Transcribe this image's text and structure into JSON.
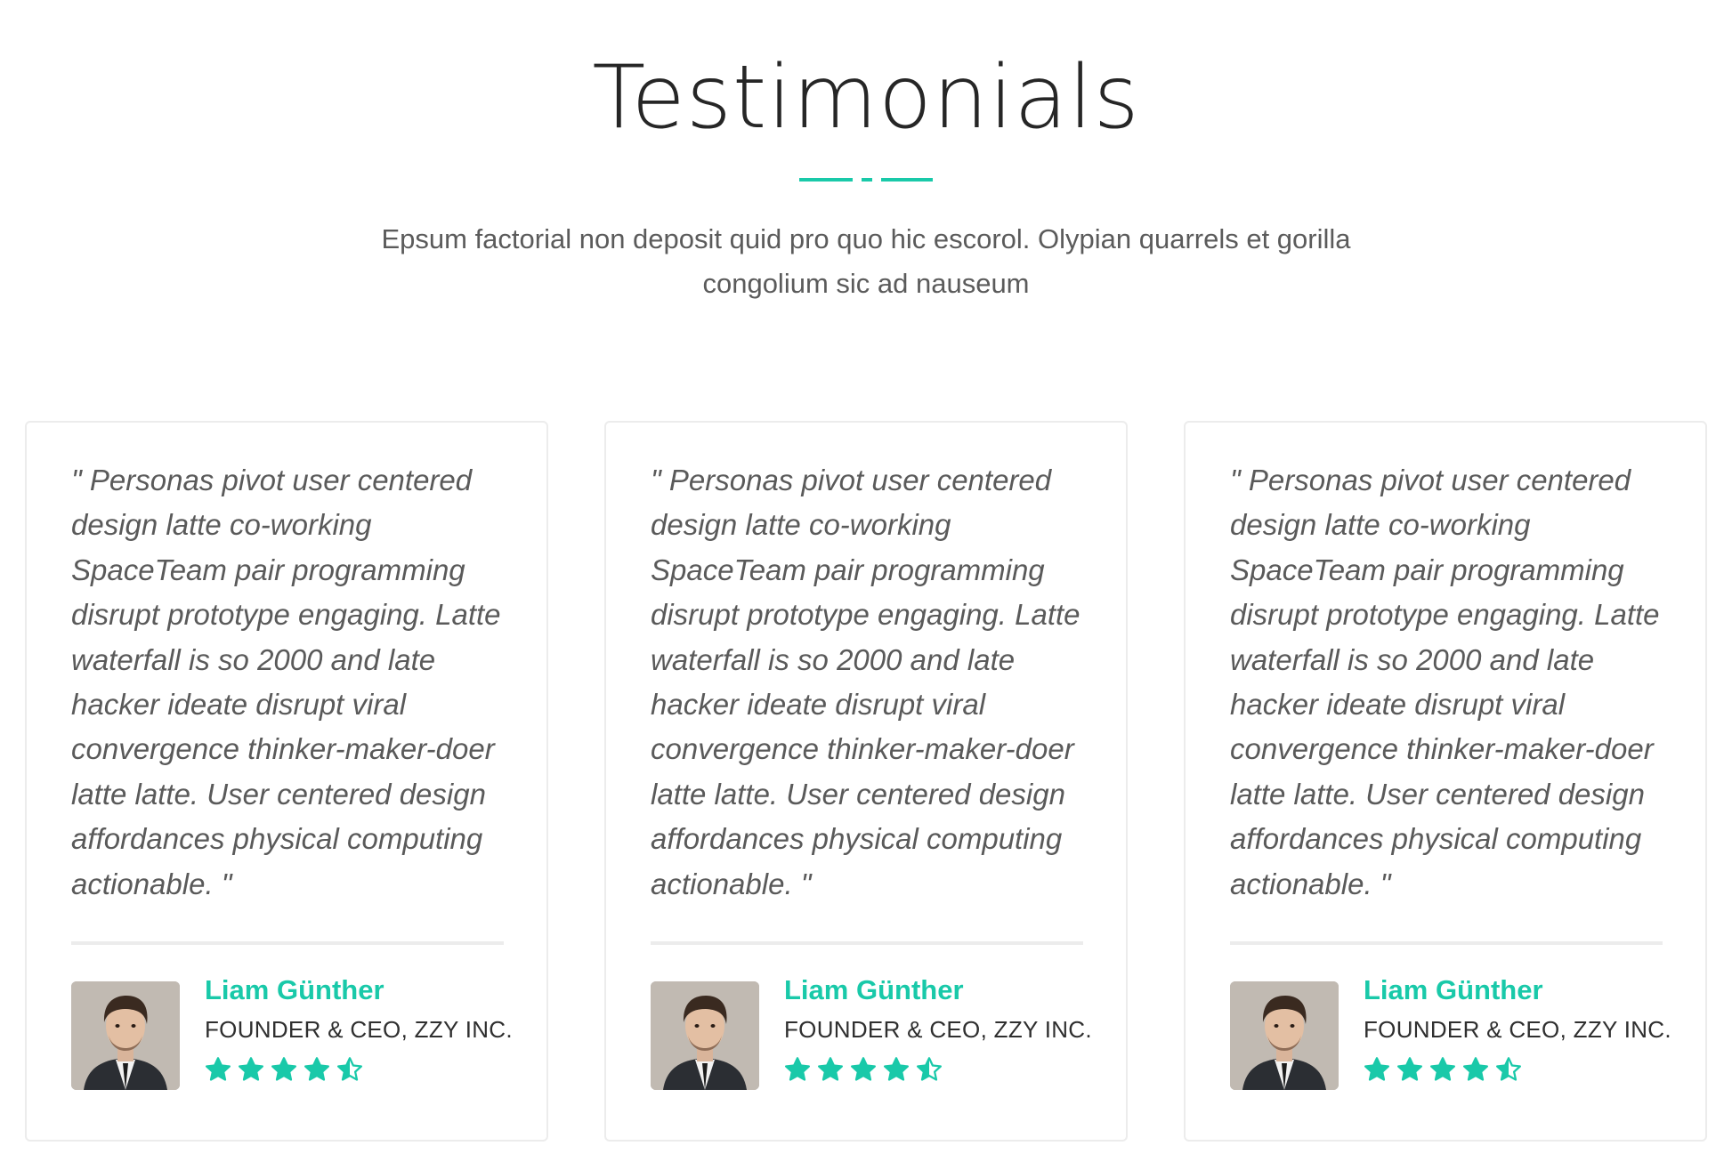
{
  "header": {
    "title": "Testimonials",
    "subtitle": "Epsum factorial non deposit quid pro quo hic escorol. Olypian quarrels et gorilla congolium sic ad nauseum"
  },
  "colors": {
    "accent": "#19c9a9",
    "text": "#5a5a5a",
    "border": "#ececec"
  },
  "testimonials": [
    {
      "quote": "\" Personas pivot user centered design latte co-working SpaceTeam pair programming disrupt prototype engaging. Latte waterfall is so 2000 and late hacker ideate disrupt viral convergence thinker-maker-doer latte latte. User centered design affordances physical computing actionable. \"",
      "name": "Liam Günther",
      "role": "FOUNDER & CEO, ZZY INC.",
      "rating": 4.5,
      "rating_max": 5
    },
    {
      "quote": "\" Personas pivot user centered design latte co-working SpaceTeam pair programming disrupt prototype engaging. Latte waterfall is so 2000 and late hacker ideate disrupt viral convergence thinker-maker-doer latte latte. User centered design affordances physical computing actionable. \"",
      "name": "Liam Günther",
      "role": "FOUNDER & CEO, ZZY INC.",
      "rating": 4.5,
      "rating_max": 5
    },
    {
      "quote": "\" Personas pivot user centered design latte co-working SpaceTeam pair programming disrupt prototype engaging. Latte waterfall is so 2000 and late hacker ideate disrupt viral convergence thinker-maker-doer latte latte. User centered design affordances physical computing actionable. \"",
      "name": "Liam Günther",
      "role": "FOUNDER & CEO, ZZY INC.",
      "rating": 4.5,
      "rating_max": 5
    }
  ]
}
